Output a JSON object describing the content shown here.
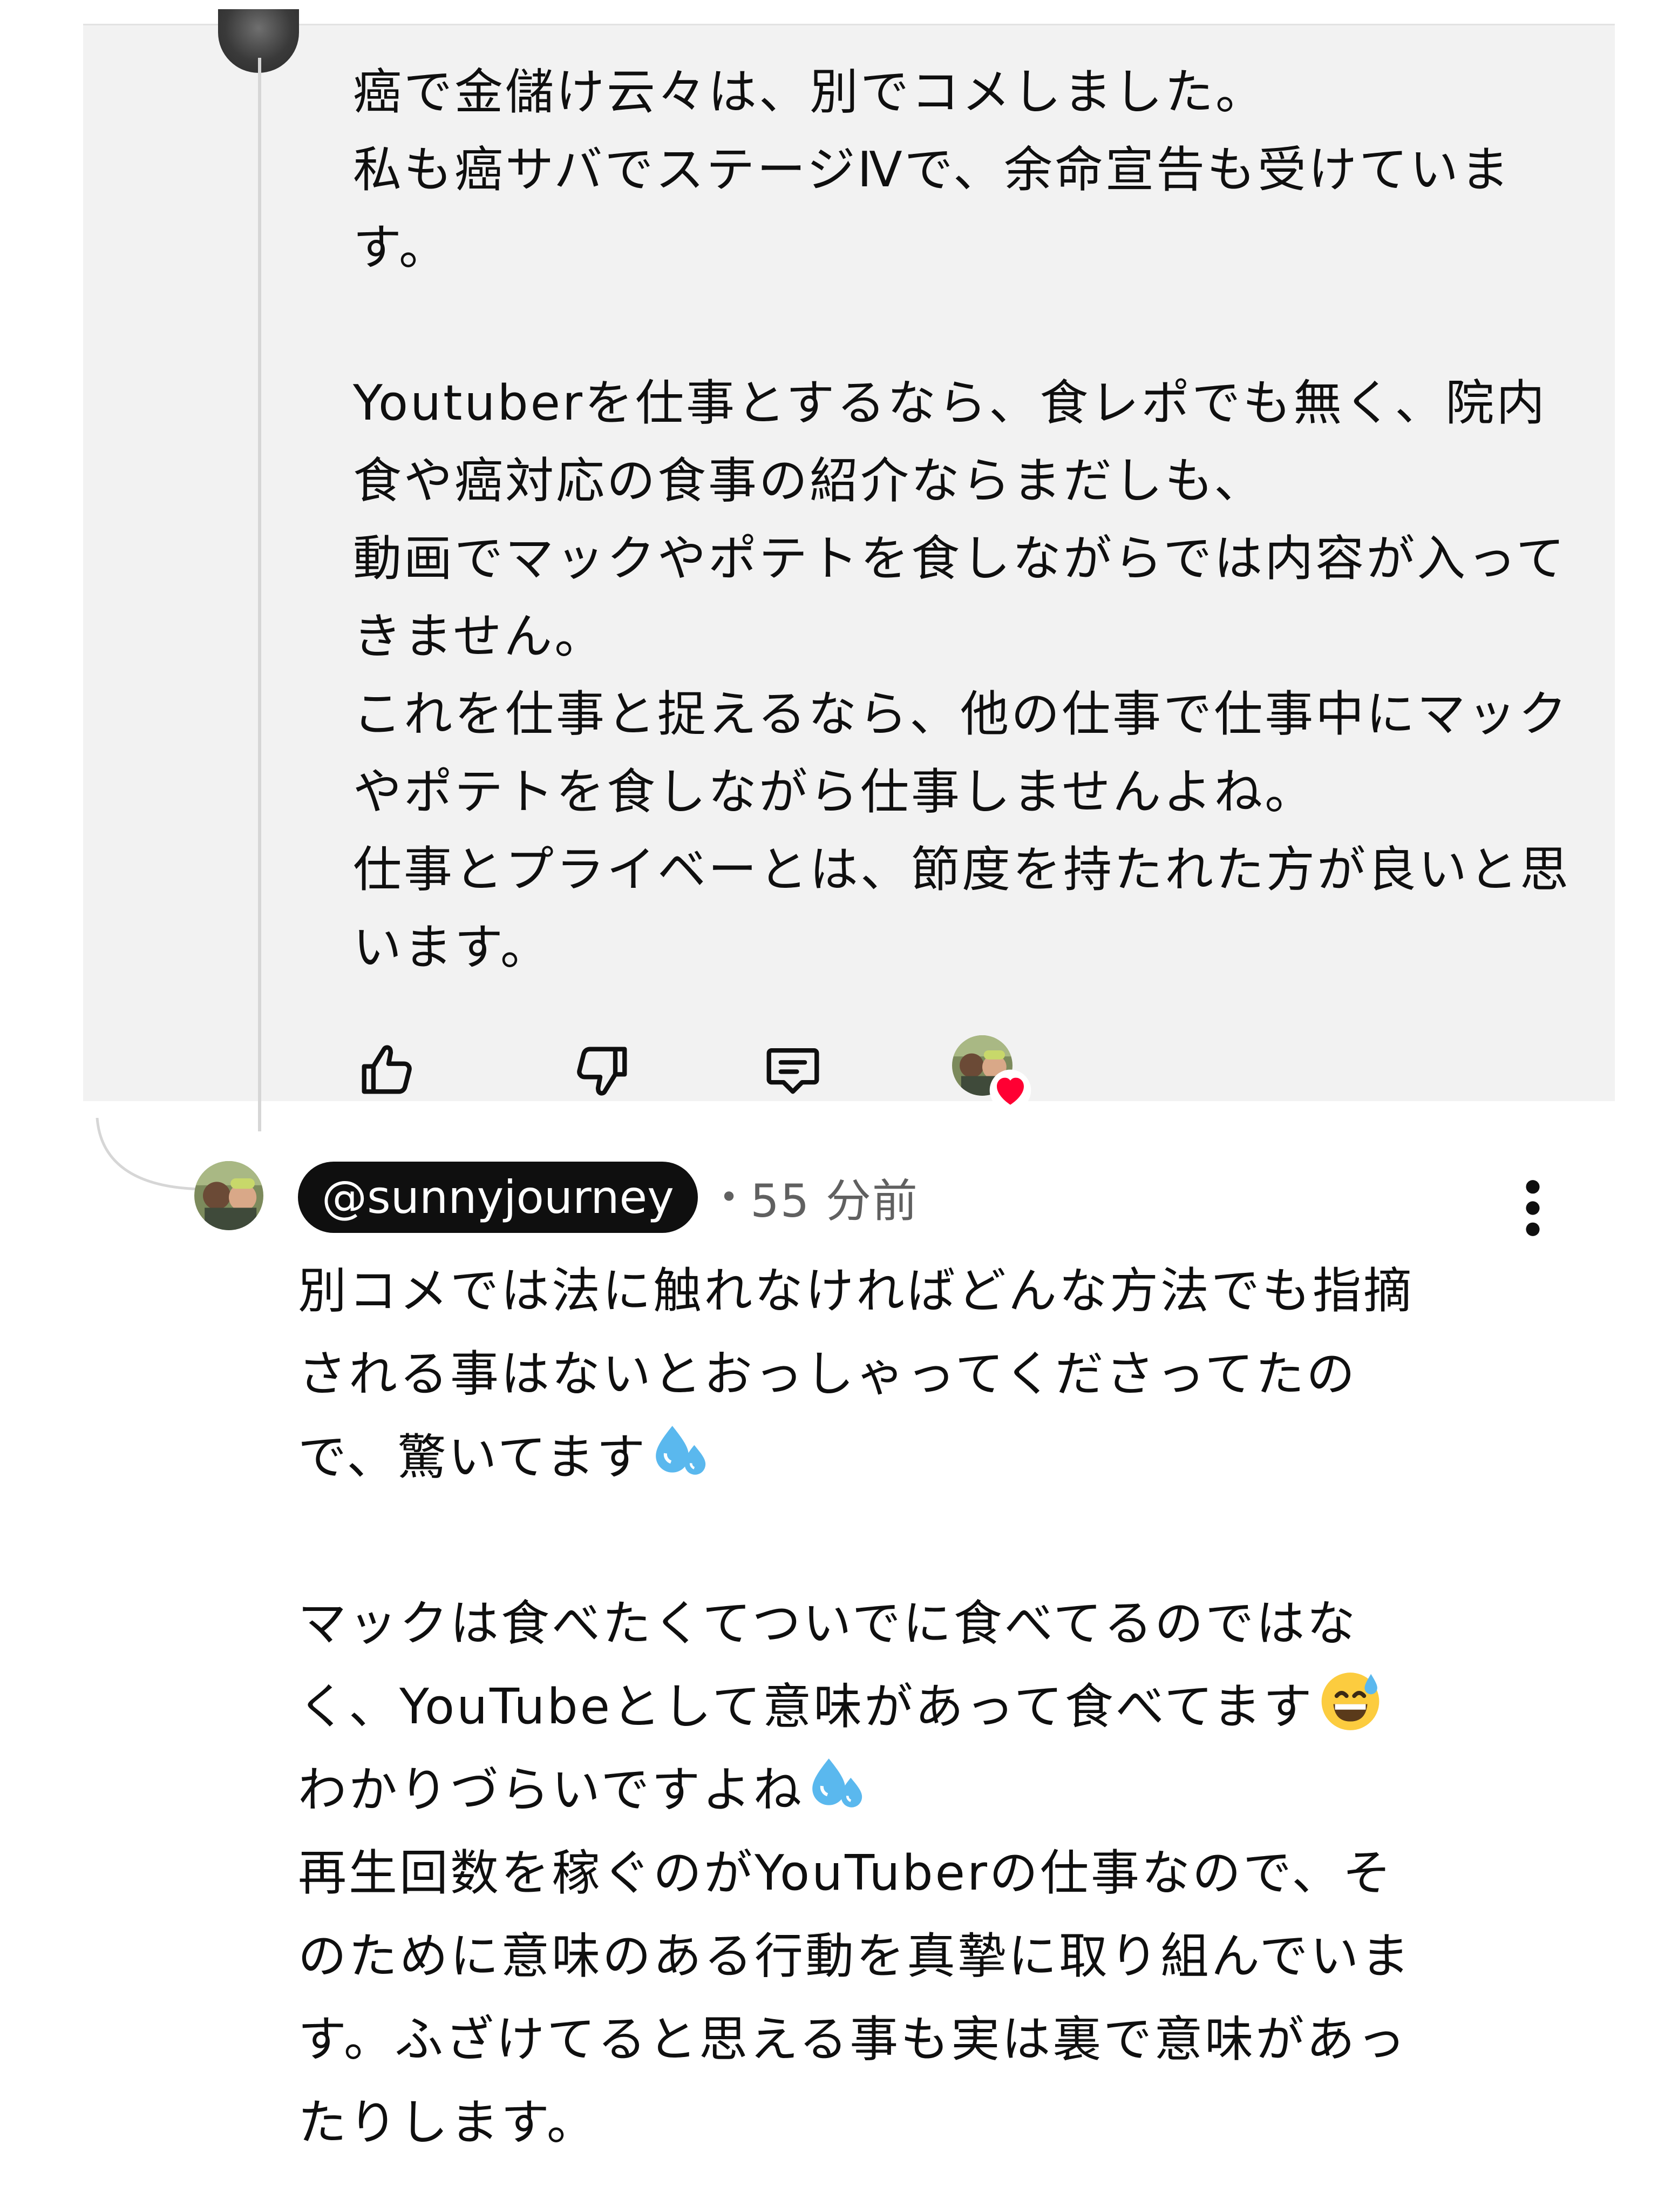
{
  "parent_comment": {
    "lines": [
      "癌で金儲け云々は、別でコメしました。",
      "私も癌サバでステージⅣで、余命宣告も受けていま",
      "す。",
      "",
      "Youtuberを仕事とするなら、食レポでも無く、院内",
      "食や癌対応の食事の紹介ならまだしも、",
      "動画でマックやポテトを食しながらでは内容が入って",
      "きません。",
      "これを仕事と捉えるなら、他の仕事で仕事中にマック",
      "やポテトを食しながら仕事しませんよね。",
      "仕事とプライベーとは、節度を持たれた方が良いと思",
      "います。"
    ],
    "actions": {
      "like_icon": "thumb-up-icon",
      "dislike_icon": "thumb-down-icon",
      "reply_icon": "comment-icon",
      "creator_heart_icon": "creator-heart-icon"
    }
  },
  "reply": {
    "handle": "@sunnyjourney",
    "separator": "•",
    "time": "55 分前",
    "menu_icon": "more-vertical-icon",
    "lines": [
      {
        "text": "別コメでは法に触れなければどんな方法でも指摘"
      },
      {
        "text": "される事はないとおっしゃってくださってたの"
      },
      {
        "text": "で、驚いてます",
        "emoji": "sweat-droplets"
      },
      {
        "text": ""
      },
      {
        "text": "マックは食べたくてついでに食べてるのではな"
      },
      {
        "text": "く、YouTubeとして意味があって食べてます",
        "emoji": "grinning-sweat"
      },
      {
        "text": "わかりづらいですよね",
        "emoji": "sweat-droplets"
      },
      {
        "text": "再生回数を稼ぐのがYouTuberの仕事なので、そ"
      },
      {
        "text": "のために意味のある行動を真摯に取り組んでいま"
      },
      {
        "text": "す。ふざけてると思える事も実は裏で意味があっ"
      },
      {
        "text": "たりします。"
      }
    ]
  },
  "colors": {
    "highlight_bg": "#f2f2f2",
    "text": "#0f0f0f",
    "meta": "#606060",
    "heart": "#ff0033",
    "thread_line": "#d6d6d6"
  }
}
